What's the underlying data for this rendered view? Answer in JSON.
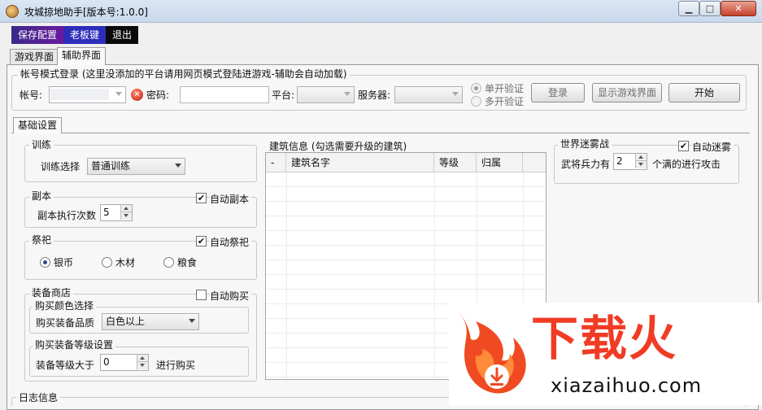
{
  "window": {
    "title": "攻城掠地助手[版本号:1.0.0]",
    "min_label": "▁",
    "max_label": "□",
    "close_label": "✕"
  },
  "toolbar": {
    "save_label": "保存配置",
    "boss_label": "老板键",
    "exit_label": "退出"
  },
  "tabs": [
    {
      "label": "游戏界面",
      "active": false
    },
    {
      "label": "辅助界面",
      "active": true
    }
  ],
  "login": {
    "group_title": "帐号模式登录 (这里没添加的平台请用网页模式登陆进游戏-辅助会自动加载)",
    "account_label": "帐号:",
    "account_value": "",
    "password_label": "密码:",
    "password_value": "",
    "platform_label": "平台:",
    "platform_value": "",
    "server_label": "服务器:",
    "server_value": "",
    "single_verify_label": "单开验证",
    "multi_verify_label": "多开验证",
    "login_button": "登录",
    "show_game_button": "显示游戏界面",
    "start_button": "开始"
  },
  "subtab": {
    "label": "基础设置"
  },
  "training": {
    "group_title": "训练",
    "select_label": "训练选择",
    "select_value": "普通训练"
  },
  "dungeon": {
    "group_title": "副本",
    "auto_label": "自动副本",
    "auto_checked": true,
    "count_label": "副本执行次数",
    "count_value": "5"
  },
  "sacrifice": {
    "group_title": "祭祀",
    "auto_label": "自动祭祀",
    "auto_checked": true,
    "options": [
      "银币",
      "木材",
      "粮食"
    ],
    "selected": "银币"
  },
  "equipment_shop": {
    "group_title": "装备商店",
    "auto_label": "自动购买",
    "auto_checked": false,
    "color_group_title": "购买颜色选择",
    "quality_label": "购买装备品质",
    "quality_value": "白色以上",
    "level_group_title": "购买装备等级设置",
    "level_label": "装备等级大于",
    "level_value": "0",
    "level_suffix": "进行购买"
  },
  "buildings": {
    "group_title": "建筑信息 (勾选需要升级的建筑)",
    "columns": [
      "-",
      "建筑名字",
      "等级",
      "归属"
    ]
  },
  "fog_war": {
    "group_title": "世界迷雾战",
    "auto_label": "自动迷雾",
    "auto_checked": true,
    "prefix_label": "武将兵力有",
    "value": "2",
    "suffix_label": "个满的进行攻击"
  },
  "log": {
    "group_title": "日志信息"
  },
  "watermark": {
    "logo_text": "下载火",
    "url_text": "xiazaihuo.com",
    "brand_color": "#f03c24"
  }
}
